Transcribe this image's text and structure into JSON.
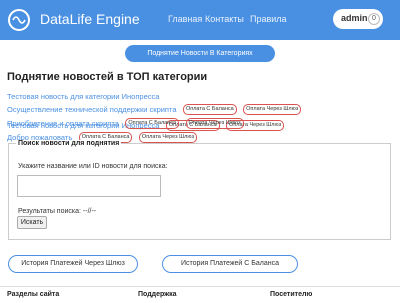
{
  "header": {
    "brand": "DataLife Engine",
    "nav": [
      "Главная",
      "Контакты",
      "Правила"
    ],
    "user": "admin",
    "badge": "0",
    "colors": {
      "header_bg": "#4a90e2",
      "tag_border": "#d9534f"
    }
  },
  "top_button": "Поднятие Новости В Категориях",
  "page_title": "Поднятие новостей в ТОП категории",
  "news": [
    {
      "title": "Тестовая новость для категории Инопресса",
      "tags": [
        "Оплата С Баланса",
        "Оплата Через Шлюз"
      ]
    },
    {
      "title": "Осуществление технической поддержки скрипта",
      "tags": [
        "Оплата С Баланса",
        "Оплата Через Шлюз"
      ]
    },
    {
      "title": "Приобретение и оплата скрипта",
      "tags": [
        "Оплата С Баланса",
        "Оплата Через Шлюз"
      ]
    },
    {
      "title": "Добро пожаловать",
      "tags": [
        "Оплата С Баланса",
        "Оплата Через Шлюз"
      ]
    }
  ],
  "search": {
    "legend": "Поиск новости для поднятия",
    "label": "Укажите название или ID новости для поиска:",
    "value": "",
    "results_label": "Результаты поиска: --//--",
    "button": "Искать"
  },
  "history_buttons": [
    "История Платежей Через Шлюз",
    "История Платежей С Баланса"
  ],
  "footer": [
    "Разделы сайта",
    "Поддержка",
    "Посетителю"
  ]
}
